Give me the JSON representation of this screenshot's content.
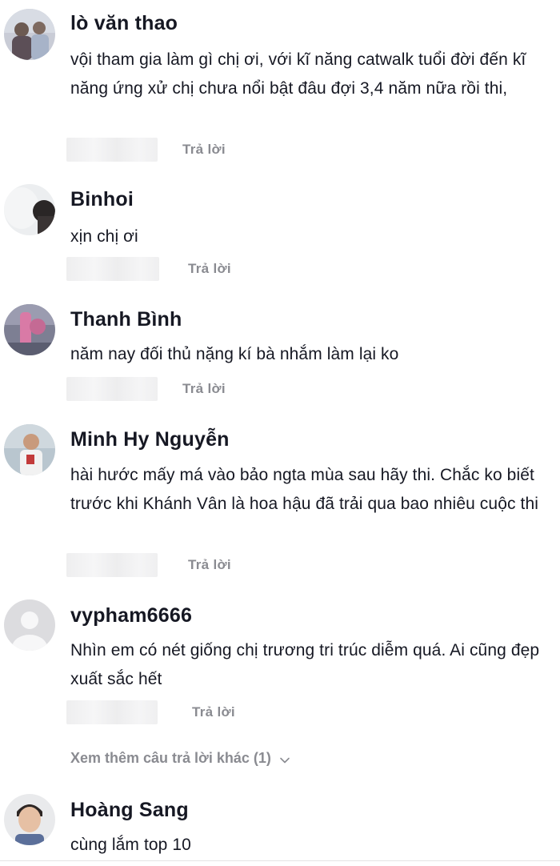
{
  "comments": [
    {
      "username": "lò văn thao",
      "text": "vội tham gia làm gì chị ơi, với kĩ năng catwalk tuổi đời đến kĩ năng ứng xử chị chưa nổi bật đâu đợi 3,4 năm nữa rồi thi,",
      "reply_label": "Trả lời",
      "avatar_icon": "photo-avatar-two-people"
    },
    {
      "username": "Binhoi",
      "text": "xịn chị ơi",
      "reply_label": "Trả lời",
      "avatar_icon": "photo-avatar-silhouette"
    },
    {
      "username": "Thanh Bình",
      "text": "năm nay đối thủ nặng kí bà nhắm làm lại ko",
      "reply_label": "Trả lời",
      "avatar_icon": "photo-avatar-pink-object"
    },
    {
      "username": "Minh Hy Nguyễn",
      "text": "hài hước mấy má vào bảo ngta mùa sau hãy thi. Chắc ko biết trước khi Khánh Vân là hoa hậu đã trải qua bao nhiêu cuộc thi ",
      "reply_label": "Trả lời",
      "avatar_icon": "photo-avatar-basketball-player"
    },
    {
      "username": "vypham6666",
      "text": "Nhìn em có nét giống chị trương tri trúc diễm quá. Ai cũng đẹp xuất sắc hết",
      "reply_label": "Trả lời",
      "avatar_icon": "default-user-avatar-icon"
    },
    {
      "username": "Hoàng Sang",
      "text": "cùng lắm top 10",
      "avatar_icon": "photo-avatar-young-man"
    }
  ],
  "view_more": {
    "label": "Xem thêm câu trả lời khác (1)",
    "icon": "chevron-down-icon"
  },
  "colors": {
    "username": "#161823",
    "text": "#161823",
    "secondary": "#8a8b91",
    "blur_bar": "#efeff0",
    "default_avatar_bg": "#dcdcdf"
  }
}
